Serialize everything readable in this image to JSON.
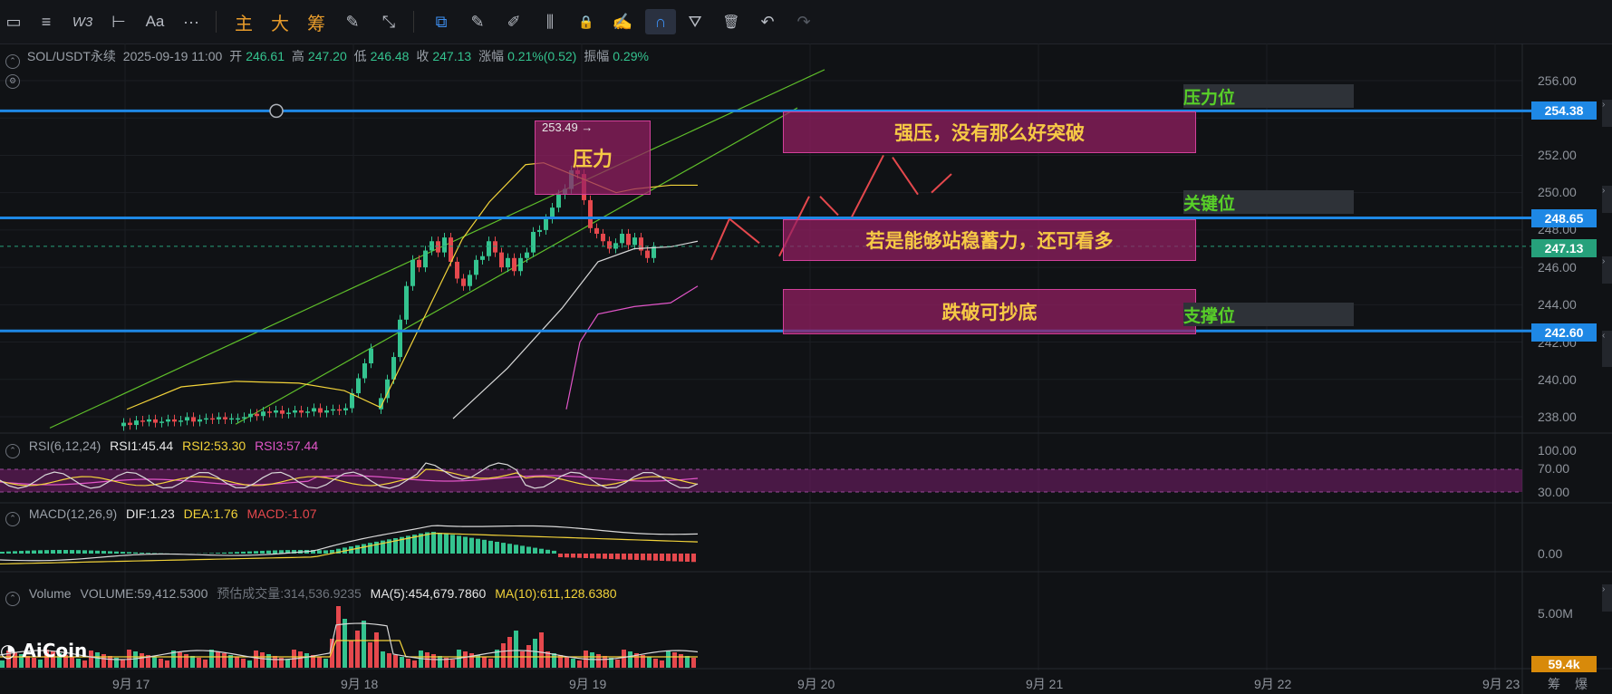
{
  "toolbar": {
    "items": [
      {
        "name": "rect-tool-icon",
        "glyph": "▭"
      },
      {
        "name": "lines-tool-icon",
        "glyph": "≡"
      },
      {
        "name": "wave-tool-icon",
        "glyph": "W3"
      },
      {
        "name": "hline-tool-icon",
        "glyph": "⊢"
      },
      {
        "name": "text-tool-icon",
        "glyph": "Aa"
      },
      {
        "name": "more-icon",
        "glyph": "···"
      }
    ],
    "modes": [
      "主",
      "大",
      "筹"
    ],
    "tools": [
      {
        "name": "copy-icon",
        "glyph": "⧉"
      },
      {
        "name": "ruler-icon",
        "glyph": "✎"
      },
      {
        "name": "pen-icon",
        "glyph": "✐"
      },
      {
        "name": "candles-icon",
        "glyph": "⫼"
      },
      {
        "name": "lock-icon",
        "glyph": "🔒"
      },
      {
        "name": "note-icon",
        "glyph": "✍"
      },
      {
        "name": "magnet-icon",
        "glyph": "∩"
      },
      {
        "name": "filter-icon",
        "glyph": "⛛"
      },
      {
        "name": "trash-icon",
        "glyph": "🗑"
      },
      {
        "name": "undo-icon",
        "glyph": "↶"
      },
      {
        "name": "redo-icon",
        "glyph": "↷"
      }
    ]
  },
  "header": {
    "symbol": "SOL/USDT永续",
    "datetime": "2025-09-19 11:00",
    "open_label": "开",
    "open": "246.61",
    "high_label": "高",
    "high": "247.20",
    "low_label": "低",
    "low": "246.48",
    "close_label": "收",
    "close": "247.13",
    "change_label": "涨幅",
    "change": "0.21%(0.52)",
    "amp_label": "振幅",
    "amp": "0.29%"
  },
  "annotations": {
    "pressure_box": "压力",
    "peak_label": "253.49 →",
    "strong_pressure": "强压，没有那么好突破",
    "hold_above": "若是能够站稳蓄力，还可看多",
    "break_buy": "跌破可抄底",
    "level_resistance": "压力位",
    "level_key": "关键位",
    "level_support": "支撑位"
  },
  "price_axis": {
    "ticks": [
      "256.00",
      "252.00",
      "250.00",
      "248.00",
      "246.00",
      "244.00",
      "242.00",
      "240.00",
      "238.00"
    ],
    "tags": [
      {
        "label": "254.38",
        "color": "#1e88e5"
      },
      {
        "label": "248.65",
        "color": "#1e88e5"
      },
      {
        "label": "247.13",
        "color": "#26a17b"
      },
      {
        "label": "242.60",
        "color": "#1e88e5"
      }
    ]
  },
  "rsi": {
    "name": "RSI(6,12,24)",
    "rsi1": "RSI1:45.44",
    "rsi2": "RSI2:53.30",
    "rsi3": "RSI3:57.44",
    "ticks": [
      "100.00",
      "70.00",
      "30.00"
    ]
  },
  "macd": {
    "name": "MACD(12,26,9)",
    "dif": "DIF:1.23",
    "dea": "DEA:1.76",
    "macd": "MACD:-1.07",
    "ticks": [
      "0.00"
    ]
  },
  "volume": {
    "name": "Volume",
    "vol": "VOLUME:59,412.5300",
    "est": "预估成交量:314,536.9235",
    "ma5": "MA(5):454,679.7860",
    "ma10": "MA(10):611,128.6380",
    "ticks": [
      "5.00M"
    ],
    "tag": "59.4k"
  },
  "logo": "AiCoin",
  "time_axis": {
    "labels": [
      "9月 17",
      "9月 18",
      "9月 19",
      "9月 20",
      "9月 21",
      "9月 22",
      "9月 23"
    ],
    "extra": [
      "筹",
      "爆"
    ]
  },
  "colors": {
    "up": "#34c38f",
    "down": "#e5484d",
    "level_line": "#1e88e5",
    "ma_yellow": "#f2d33a",
    "ma_white": "#d8d8d8",
    "ma_magenta": "#e155c8",
    "annot_text": "#f6c945",
    "level_text": "#58d028"
  }
}
